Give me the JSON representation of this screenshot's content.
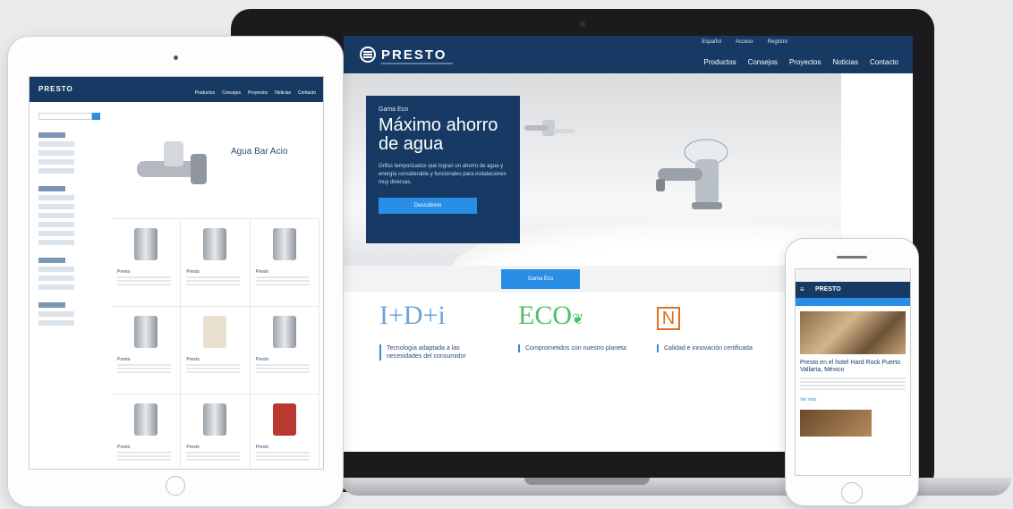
{
  "laptop": {
    "logo": "PRESTO",
    "top_links": [
      "Español",
      "Acceso",
      "Registro"
    ],
    "nav": [
      "Productos",
      "Consejos",
      "Proyectos",
      "Noticias",
      "Contacto"
    ],
    "promo": {
      "kicker": "Gama Eco",
      "title": "Máximo ahorro de agua",
      "text": "Grifos temporizados que logran un ahorro de agua y energía considerable y funcionales para instalaciones muy diversas.",
      "button": "Descúbrelo"
    },
    "tabs": [
      "",
      "",
      "Gama Eco",
      "",
      ""
    ],
    "features": [
      {
        "logo": "I+D+i",
        "title": "Tecnología adaptada a las necesidades del consumidor",
        "text": ""
      },
      {
        "logo": "ECO",
        "title": "Comprometidos con nuestro planeta",
        "text": ""
      },
      {
        "logo": "N",
        "title": "Calidad e innovación certificada",
        "text": ""
      }
    ],
    "colors": {
      "header": "#163a63",
      "accent": "#2a8de6"
    }
  },
  "tablet": {
    "logo": "PRESTO",
    "nav": [
      "Productos",
      "Consejos",
      "Proyectos",
      "Noticias",
      "Contacto"
    ],
    "filters": [
      "",
      ""
    ],
    "featured": {
      "kicker": "",
      "title": "Agua Bar Acio"
    },
    "products": [
      {
        "name": "Presto"
      },
      {
        "name": "Presto"
      },
      {
        "name": "Presto"
      },
      {
        "name": "Presto"
      },
      {
        "name": "Presto"
      },
      {
        "name": "Presto"
      },
      {
        "name": "Presto"
      },
      {
        "name": "Presto"
      },
      {
        "name": "Presto"
      }
    ]
  },
  "phone": {
    "url": "",
    "logo": "PRESTO",
    "article": {
      "kicker": "",
      "title": "Presto en el hotel Hard Rock Puerto Vallarta, México",
      "link": "Ver más"
    }
  }
}
